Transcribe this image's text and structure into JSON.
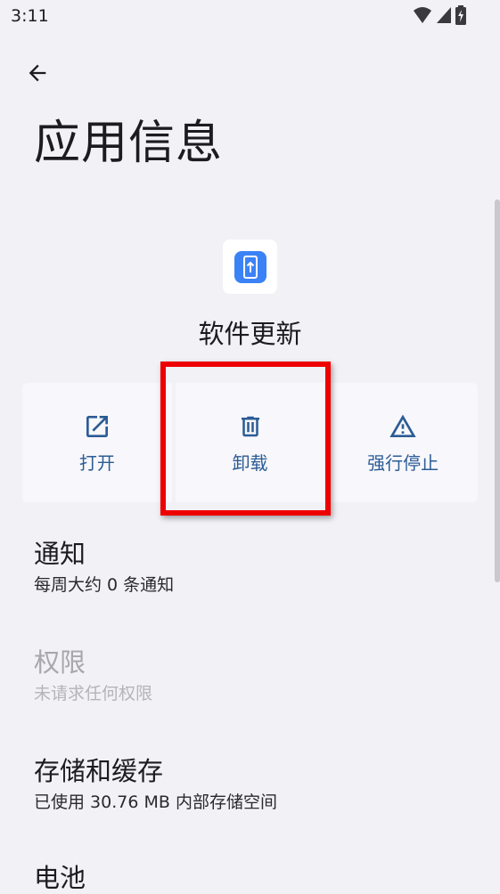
{
  "status_bar": {
    "time": "3:11",
    "icons": [
      "wifi-icon",
      "signal-icon",
      "battery-icon"
    ]
  },
  "header": {
    "back_icon": "arrow-left-icon",
    "title": "应用信息"
  },
  "app": {
    "icon": "phone-update-icon",
    "name": "软件更新"
  },
  "actions": [
    {
      "icon": "open-external-icon",
      "label": "打开"
    },
    {
      "icon": "trash-icon",
      "label": "卸载"
    },
    {
      "icon": "warning-icon",
      "label": "强行停止"
    }
  ],
  "settings": [
    {
      "title": "通知",
      "subtitle": "每周大约 0 条通知",
      "enabled": true
    },
    {
      "title": "权限",
      "subtitle": "未请求任何权限",
      "enabled": false
    },
    {
      "title": "存储和缓存",
      "subtitle": "已使用 30.76 MB 内部存储空间",
      "enabled": true
    },
    {
      "title": "电池",
      "subtitle": "",
      "enabled": true
    }
  ],
  "colors": {
    "background": "#f2f1f6",
    "accent": "#2b5c95",
    "highlight": "#ee0000",
    "app_icon_blue": "#3b82f6"
  }
}
